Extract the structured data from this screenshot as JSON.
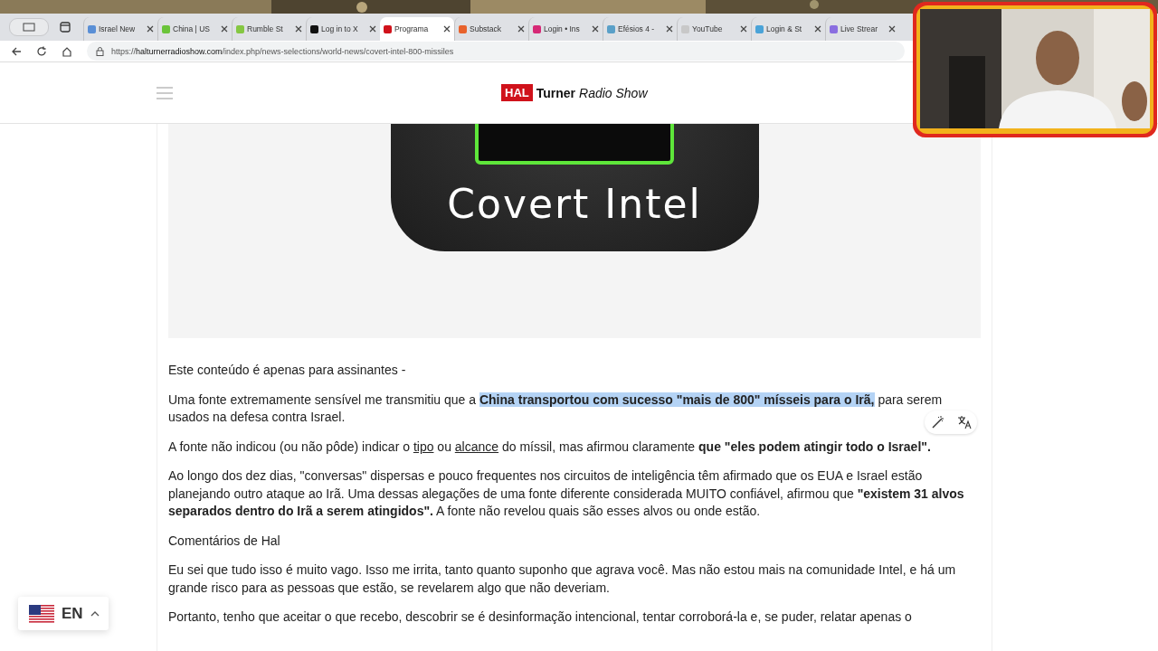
{
  "browser": {
    "tabs": [
      {
        "label": "Israel New",
        "color": "#5a8fd6",
        "selected": false
      },
      {
        "label": "China | US",
        "color": "#6bc43a",
        "selected": false
      },
      {
        "label": "Rumble St",
        "color": "#85c742",
        "selected": false
      },
      {
        "label": "Log in to X",
        "color": "#111111",
        "selected": false
      },
      {
        "label": "Programa",
        "color": "#d0121b",
        "selected": true
      },
      {
        "label": "Substack",
        "color": "#e8622c",
        "selected": false
      },
      {
        "label": "Login • Ins",
        "color": "#d62976",
        "selected": false
      },
      {
        "label": "Efésios 4 -",
        "color": "#5aa0c8",
        "selected": false
      },
      {
        "label": "YouTube",
        "color": "#c8c8c8",
        "selected": false
      },
      {
        "label": "Login & St",
        "color": "#4aa3d8",
        "selected": false
      },
      {
        "label": "Live Strear",
        "color": "#8a6ee0",
        "selected": false
      }
    ],
    "url": {
      "scheme": "https://",
      "host": "halturnerradioshow.com",
      "path": "/index.php/news-selections/world-news/covert-intel-800-missiles"
    }
  },
  "header": {
    "logo_badge": "HAL",
    "logo_name": "Turner",
    "logo_tagline": "Radio Show"
  },
  "hero": {
    "caption": "Covert Intel"
  },
  "article": [
    [
      {
        "kind": "plain",
        "text": "Este conteúdo é apenas para assinantes -"
      }
    ],
    [
      {
        "kind": "plain",
        "text": "Uma fonte extremamente sensível me transmitiu que a "
      },
      {
        "kind": "highlight",
        "text": "China transportou com sucesso \"mais de 800\" mísseis para o Irã,"
      },
      {
        "kind": "plain",
        "text": " para serem usados na defesa contra Israel."
      }
    ],
    [
      {
        "kind": "plain",
        "text": "A fonte não indicou (ou não pôde) indicar o "
      },
      {
        "kind": "link",
        "text": "tipo"
      },
      {
        "kind": "plain",
        "text": " ou "
      },
      {
        "kind": "link",
        "text": "alcance"
      },
      {
        "kind": "plain",
        "text": " do míssil, mas afirmou claramente "
      },
      {
        "kind": "bold",
        "text": "que \"eles podem atingir todo o Israel\"."
      }
    ],
    [
      {
        "kind": "plain",
        "text": "Ao longo dos dez dias, \"conversas\" dispersas e pouco frequentes nos circuitos de inteligência têm afirmado que os EUA e Israel estão planejando outro ataque ao Irã. Uma dessas alegações de uma fonte diferente considerada MUITO confiável, afirmou que "
      },
      {
        "kind": "bold",
        "text": "\"existem 31 alvos separados dentro do Irã a serem atingidos\"."
      },
      {
        "kind": "plain",
        "text": " A fonte não revelou quais são esses alvos ou onde estão."
      }
    ],
    [
      {
        "kind": "plain",
        "text": "Comentários de Hal"
      }
    ],
    [
      {
        "kind": "plain",
        "text": "Eu sei que tudo isso é muito vago. Isso me irrita, tanto quanto suponho que agrava você. Mas não estou mais na comunidade Intel, e há um grande risco para as pessoas que estão, se revelarem algo que não deveriam."
      }
    ],
    [
      {
        "kind": "plain",
        "text": "Portanto, tenho que aceitar o que recebo, descobrir se é desinformação intencional, tentar corroborá-la e, se puder, relatar apenas o"
      }
    ]
  ],
  "language": {
    "code": "EN"
  }
}
